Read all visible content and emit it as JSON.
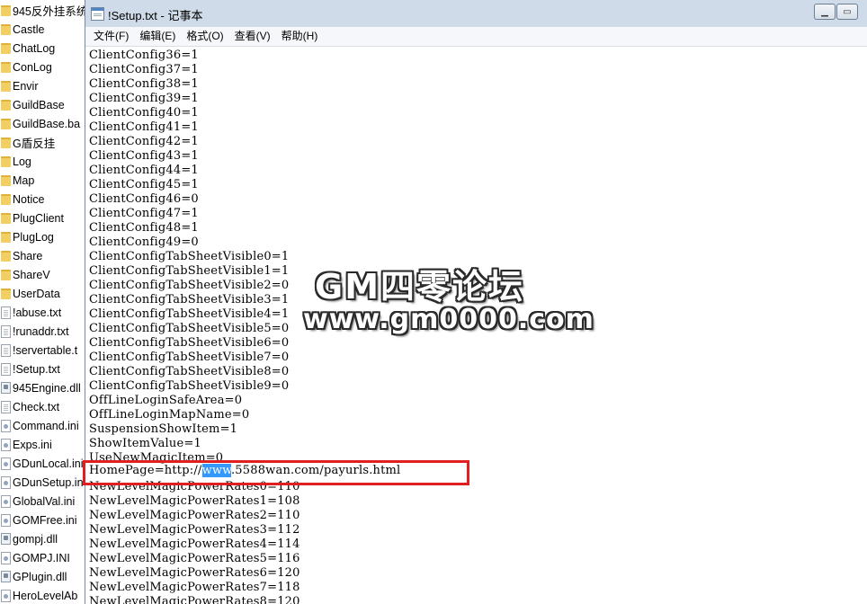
{
  "explorer": {
    "files": [
      {
        "name": "945反外挂系统",
        "type": "folder"
      },
      {
        "name": "Castle",
        "type": "folder"
      },
      {
        "name": "ChatLog",
        "type": "folder"
      },
      {
        "name": "ConLog",
        "type": "folder"
      },
      {
        "name": "Envir",
        "type": "folder"
      },
      {
        "name": "GuildBase",
        "type": "folder"
      },
      {
        "name": "GuildBase.ba",
        "type": "folder"
      },
      {
        "name": "G盾反挂",
        "type": "folder"
      },
      {
        "name": "Log",
        "type": "folder"
      },
      {
        "name": "Map",
        "type": "folder"
      },
      {
        "name": "Notice",
        "type": "folder"
      },
      {
        "name": "PlugClient",
        "type": "folder"
      },
      {
        "name": "PlugLog",
        "type": "folder"
      },
      {
        "name": "Share",
        "type": "folder"
      },
      {
        "name": "ShareV",
        "type": "folder"
      },
      {
        "name": "UserData",
        "type": "folder"
      },
      {
        "name": "!abuse.txt",
        "type": "text"
      },
      {
        "name": "!runaddr.txt",
        "type": "text"
      },
      {
        "name": "!servertable.t",
        "type": "text"
      },
      {
        "name": "!Setup.txt",
        "type": "text"
      },
      {
        "name": "945Engine.dll",
        "type": "dll"
      },
      {
        "name": "Check.txt",
        "type": "text"
      },
      {
        "name": "Command.ini",
        "type": "ini"
      },
      {
        "name": "Exps.ini",
        "type": "ini"
      },
      {
        "name": "GDunLocal.ini",
        "type": "ini"
      },
      {
        "name": "GDunSetup.in",
        "type": "ini"
      },
      {
        "name": "GlobalVal.ini",
        "type": "ini"
      },
      {
        "name": "GOMFree.ini",
        "type": "ini"
      },
      {
        "name": "gompj.dll",
        "type": "dll"
      },
      {
        "name": "GOMPJ.INI",
        "type": "ini"
      },
      {
        "name": "GPlugin.dll",
        "type": "dll"
      },
      {
        "name": "HeroLevelAb",
        "type": "ini"
      }
    ]
  },
  "notepad": {
    "title": "!Setup.txt - 记事本",
    "menu": [
      "文件(F)",
      "编辑(E)",
      "格式(O)",
      "查看(V)",
      "帮助(H)"
    ],
    "lines": [
      "ClientConfig36=1",
      "ClientConfig37=1",
      "ClientConfig38=1",
      "ClientConfig39=1",
      "ClientConfig40=1",
      "ClientConfig41=1",
      "ClientConfig42=1",
      "ClientConfig43=1",
      "ClientConfig44=1",
      "ClientConfig45=1",
      "ClientConfig46=0",
      "ClientConfig47=1",
      "ClientConfig48=1",
      "ClientConfig49=0",
      "ClientConfigTabSheetVisible0=1",
      "ClientConfigTabSheetVisible1=1",
      "ClientConfigTabSheetVisible2=0",
      "ClientConfigTabSheetVisible3=1",
      "ClientConfigTabSheetVisible4=1",
      "ClientConfigTabSheetVisible5=0",
      "ClientConfigTabSheetVisible6=0",
      "ClientConfigTabSheetVisible7=0",
      "ClientConfigTabSheetVisible8=0",
      "ClientConfigTabSheetVisible9=0",
      "OffLineLoginSafeArea=0",
      "OffLineLoginMapName=0",
      "SuspensionShowItem=1",
      "ShowItemValue=1",
      "UseNewMagicItem=0",
      "HomePage=http://www.5588wan.com/payurls.html",
      "NewLevelMagicPowerRates0=110",
      "NewLevelMagicPowerRates1=108",
      "NewLevelMagicPowerRates2=110",
      "NewLevelMagicPowerRates3=112",
      "NewLevelMagicPowerRates4=114",
      "NewLevelMagicPowerRates5=116",
      "NewLevelMagicPowerRates6=120",
      "NewLevelMagicPowerRates7=118",
      "NewLevelMagicPowerRates8=120"
    ],
    "homepage_line": {
      "prefix": "HomePage=http://",
      "selected": "www",
      "suffix": ".5588wan.com/payurls.html"
    }
  },
  "watermark": {
    "title": "GM四零论坛",
    "url": "www.gm0000.com"
  },
  "colors": {
    "highlight_border": "#e02020",
    "selection": "#3399ff"
  }
}
